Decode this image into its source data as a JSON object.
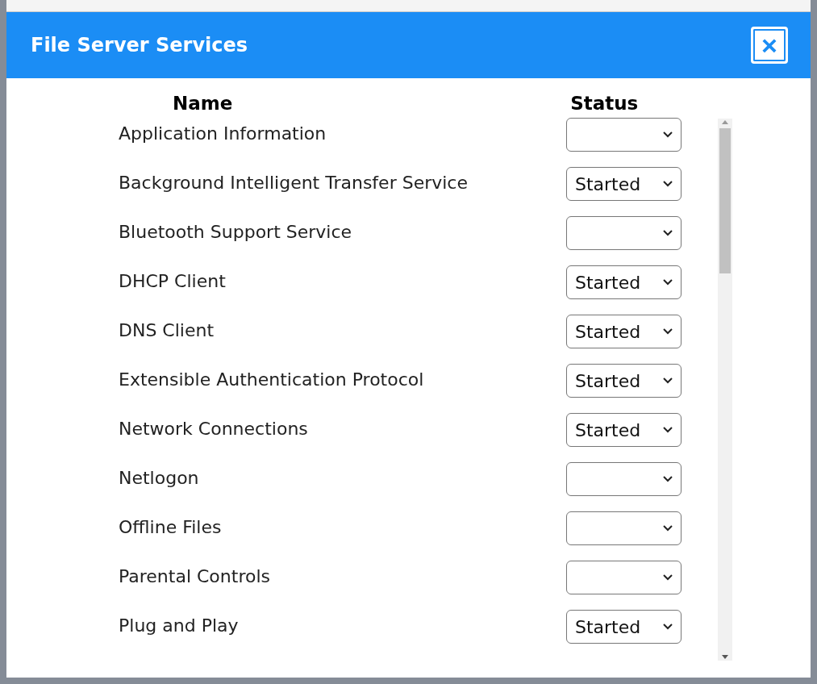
{
  "window": {
    "title": "File Server Services",
    "close_label": "×"
  },
  "columns": [
    "Name",
    "Status"
  ],
  "rows": [
    {
      "name": "Application Information"
    },
    {
      "name": "Background Intelligent Transfer Service",
      "status": "Started"
    },
    {
      "name": "Bluetooth Support Service"
    },
    {
      "name": "DHCP Client",
      "status": "Started"
    },
    {
      "name": "DNS Client",
      "status": "Started"
    },
    {
      "name": "Extensible Authentication Protocol",
      "status": "Started"
    },
    {
      "name": "Network Connections",
      "status": "Started"
    },
    {
      "name": "Netlogon"
    },
    {
      "name": "Offline Files"
    },
    {
      "name": "Parental Controls"
    },
    {
      "name": "Plug and Play",
      "status": "Started"
    }
  ]
}
